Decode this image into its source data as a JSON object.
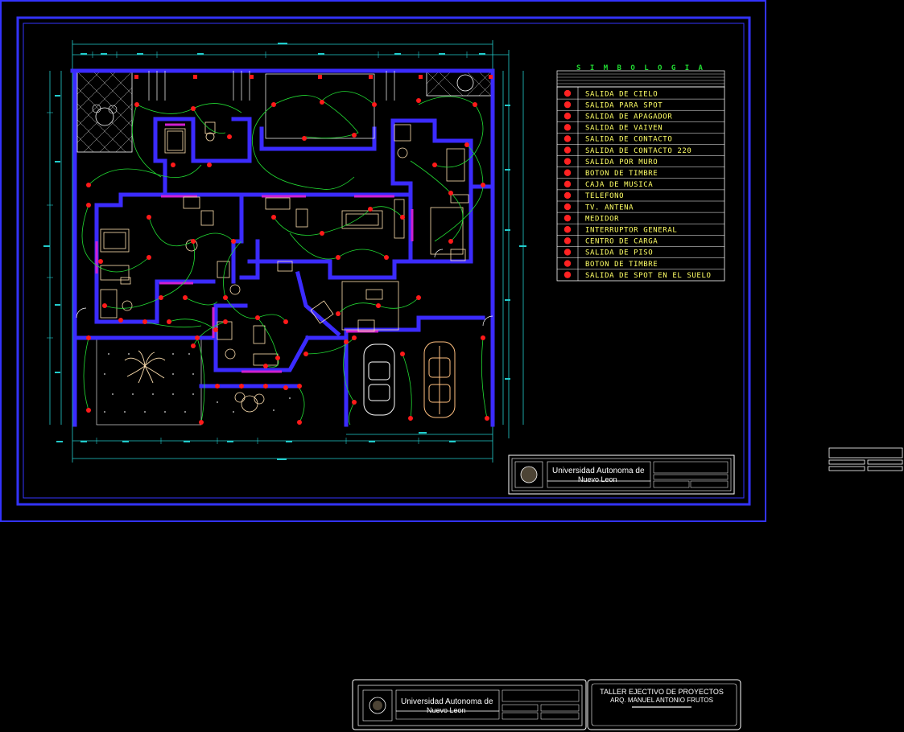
{
  "drawing": {
    "symbology_title": "S I M B O L O G I A",
    "symbology_items": [
      {
        "label": "SALIDA DE CIELO",
        "color": "#ff2222"
      },
      {
        "label": "SALIDA PARA SPOT",
        "color": "#ff2222"
      },
      {
        "label": "SALIDA DE APAGADOR",
        "color": "#ff2222"
      },
      {
        "label": "SALIDA DE VAIVEN",
        "color": "#ff2222"
      },
      {
        "label": "SALIDA DE CONTACTO",
        "color": "#ff2222"
      },
      {
        "label": "SALIDA DE CONTACTO 220",
        "color": "#ff2222"
      },
      {
        "label": "SALIDA POR MURO",
        "color": "#ff2222"
      },
      {
        "label": "BOTON DE TIMBRE",
        "color": "#ff2222"
      },
      {
        "label": "CAJA DE MUSICA",
        "color": "#ff2222"
      },
      {
        "label": "TELEFONO",
        "color": "#ff2222"
      },
      {
        "label": "TV. ANTENA",
        "color": "#ff2222"
      },
      {
        "label": "MEDIDOR",
        "color": "#ff2222"
      },
      {
        "label": "INTERRUPTOR GENERAL",
        "color": "#ff2222"
      },
      {
        "label": "CENTRO DE CARGA",
        "color": "#ff2222"
      },
      {
        "label": "SALIDA DE PISO",
        "color": "#ff2222"
      },
      {
        "label": "BOTON DE TIMBRE",
        "color": "#ff2222"
      },
      {
        "label": "SALIDA DE SPOT EN EL SUELO",
        "color": "#ff2222"
      }
    ],
    "title_block_main": {
      "university": "Universidad Autonoma de",
      "university_line2": "Nuevo Leon"
    },
    "title_block_bottom": {
      "university": "Universidad Autonoma de",
      "university_line2": "Nuevo Leon",
      "course": "TALLER EJECTIVO DE PROYECTOS",
      "teacher": "ARQ. MANUEL ANTONIO FRUTOS"
    },
    "colors": {
      "frame": "#3333ff",
      "walls": "#3b2bff",
      "walls_alt": "#d020d0",
      "wiring": "#22dd33",
      "outlets": "#ff1a1a",
      "dimensions": "#22cccc",
      "furniture": "#ffe0b0",
      "symbol_text": "#ffff66"
    }
  }
}
